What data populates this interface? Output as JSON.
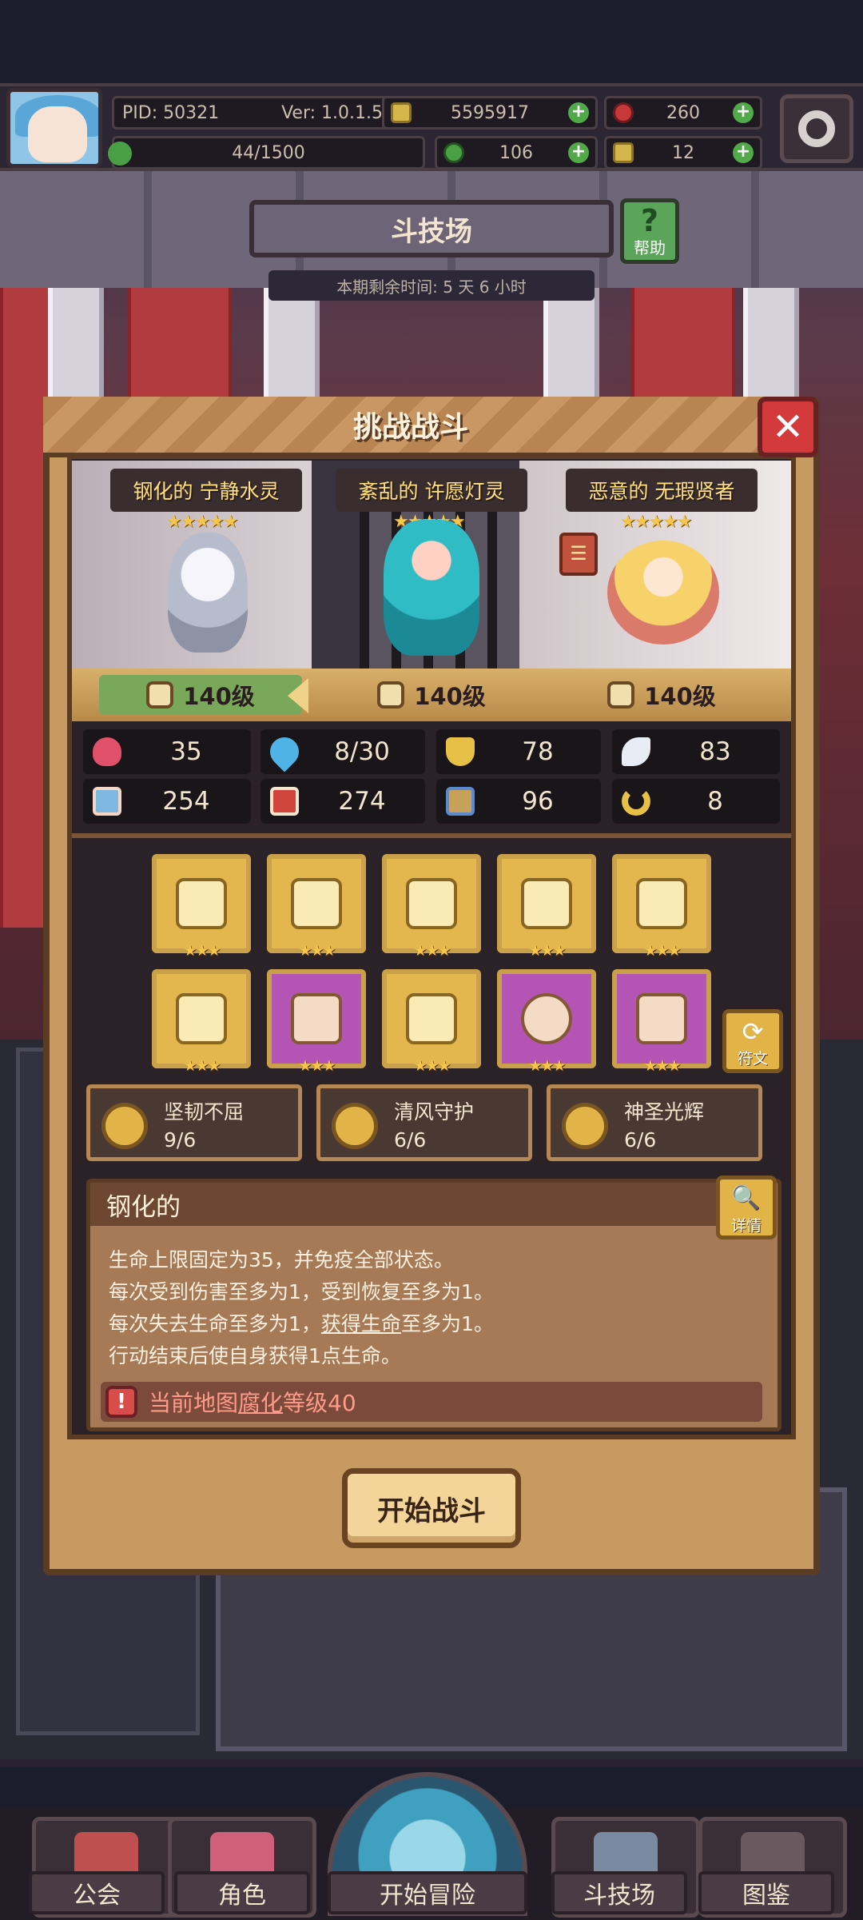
{
  "hud": {
    "pid": "PID: 50321",
    "version": "Ver: 1.0.1.5",
    "gold": "5595917",
    "gems": "260",
    "energy": "44/1500",
    "clover": "106",
    "keys": "12"
  },
  "arena": {
    "title": "斗技场",
    "help_label": "帮助",
    "season_remaining": "本期剩余时间: 5 天 6 小时"
  },
  "dialog": {
    "title": "挑战战斗",
    "close_icon": "close-icon",
    "enemies": [
      {
        "name": "钢化的 宁静水灵",
        "level": "140级",
        "stars": "★★★★★"
      },
      {
        "name": "紊乱的 许愿灯灵",
        "level": "140级",
        "stars": "★★★★★"
      },
      {
        "name": "恶意的 无瑕贤者",
        "level": "140级",
        "stars": "★★★★★"
      }
    ],
    "stats": [
      {
        "icon": "heart-icon",
        "value": "35",
        "color": "#e0506a"
      },
      {
        "icon": "water-drop-icon",
        "value": "8/30",
        "color": "#4fb3e8"
      },
      {
        "icon": "shield-icon",
        "value": "78",
        "color": "#e7c048"
      },
      {
        "icon": "wing-icon",
        "value": "83",
        "color": "#e8ecf4"
      },
      {
        "icon": "fist-icon",
        "value": "254",
        "color": "#7fb8e0"
      },
      {
        "icon": "spellbook-icon",
        "value": "274",
        "color": "#d0453e"
      },
      {
        "icon": "boot-icon",
        "value": "96",
        "color": "#c7a05a"
      },
      {
        "icon": "horseshoe-icon",
        "value": "8",
        "color": "#e7c048"
      }
    ],
    "equipment_stars": "★★★",
    "rune_label": "符文",
    "sets": [
      {
        "name": "坚韧不屈",
        "count": "9/6"
      },
      {
        "name": "清风守护",
        "count": "6/6"
      },
      {
        "name": "神圣光辉",
        "count": "6/6"
      }
    ],
    "trait": {
      "title": "钢化的",
      "detail_label": "详情",
      "line1": "生命上限固定为35，并免疫全部状态。",
      "line2": "每次受到伤害至多为1，受到恢复至多为1。",
      "line3_a": "每次失去生命至多为1，",
      "line3_b": "获得生命",
      "line3_c": "至多为1。",
      "line4": "行动结束后使自身获得1点生命。",
      "warning_prefix": "当前地图",
      "warning_key": "腐化",
      "warning_suffix": "等级40"
    },
    "start_button": "开始战斗"
  },
  "nav": {
    "guild": "公会",
    "character": "角色",
    "adventure": "开始冒险",
    "arena": "斗技场",
    "codex": "图鉴"
  }
}
